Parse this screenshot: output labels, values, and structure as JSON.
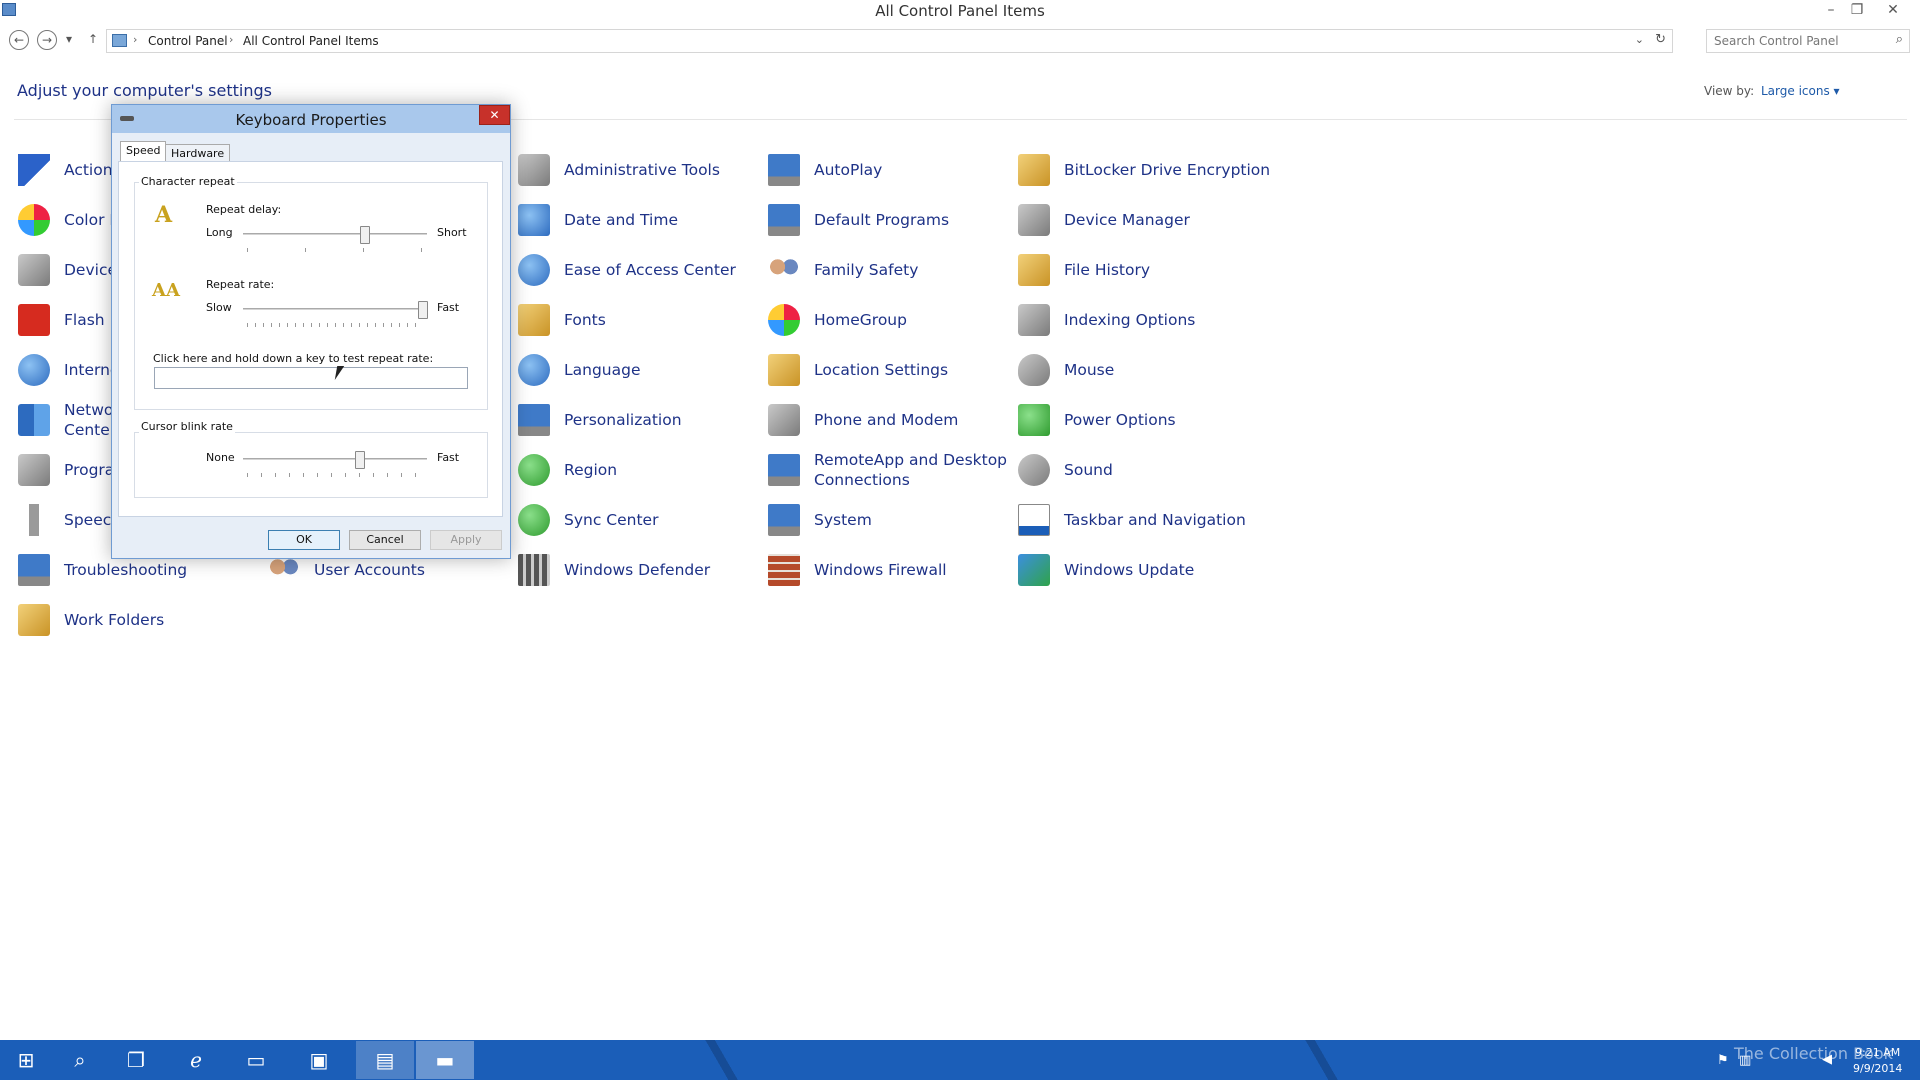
{
  "window": {
    "title": "All Control Panel Items"
  },
  "address": {
    "crumbs": [
      "Control Panel",
      "All Control Panel Items"
    ],
    "search_placeholder": "Search Control Panel"
  },
  "header": {
    "adjust": "Adjust your computer's settings",
    "view_by_label": "View by:",
    "view_by_value": "Large icons"
  },
  "items": [
    {
      "label": "Action",
      "icon": "flag-icon"
    },
    {
      "label": "Color M",
      "icon": "color-management-icon"
    },
    {
      "label": "Devices",
      "icon": "devices-printers-icon"
    },
    {
      "label": "Flash P",
      "icon": "flash-player-icon"
    },
    {
      "label": "Interne",
      "icon": "internet-options-icon"
    },
    {
      "label": "Networ",
      "label2": "Center",
      "icon": "network-sharing-icon"
    },
    {
      "label": "Progra",
      "icon": "programs-features-icon"
    },
    {
      "label": "Speech",
      "icon": "microphone-icon"
    },
    {
      "label": "Troubleshooting",
      "icon": "troubleshooting-icon"
    },
    {
      "label": "Work Folders",
      "icon": "work-folders-icon"
    },
    {
      "label": "User Accounts",
      "icon": "user-accounts-icon"
    },
    {
      "label": "Administrative Tools",
      "icon": "admin-tools-icon"
    },
    {
      "label": "Date and Time",
      "icon": "calendar-icon"
    },
    {
      "label": "Ease of Access Center",
      "icon": "ease-of-access-icon"
    },
    {
      "label": "Fonts",
      "icon": "fonts-icon"
    },
    {
      "label": "Language",
      "icon": "language-icon"
    },
    {
      "label": "Personalization",
      "icon": "personalization-icon"
    },
    {
      "label": "Region",
      "icon": "globe-icon"
    },
    {
      "label": "Sync Center",
      "icon": "sync-icon"
    },
    {
      "label": "Windows Defender",
      "icon": "defender-icon"
    },
    {
      "label": "AutoPlay",
      "icon": "autoplay-icon"
    },
    {
      "label": "Default Programs",
      "icon": "default-programs-icon"
    },
    {
      "label": "Family Safety",
      "icon": "family-safety-icon"
    },
    {
      "label": "HomeGroup",
      "icon": "homegroup-icon"
    },
    {
      "label": "Location Settings",
      "icon": "location-icon"
    },
    {
      "label": "Phone and Modem",
      "icon": "phone-icon"
    },
    {
      "label": "RemoteApp and Desktop",
      "label2": "Connections",
      "icon": "remoteapp-icon"
    },
    {
      "label": "System",
      "icon": "system-icon"
    },
    {
      "label": "Windows Firewall",
      "icon": "firewall-icon"
    },
    {
      "label": "BitLocker Drive Encryption",
      "icon": "bitlocker-icon"
    },
    {
      "label": "Device Manager",
      "icon": "device-manager-icon"
    },
    {
      "label": "File History",
      "icon": "file-history-icon"
    },
    {
      "label": "Indexing Options",
      "icon": "indexing-icon"
    },
    {
      "label": "Mouse",
      "icon": "mouse-icon"
    },
    {
      "label": "Power Options",
      "icon": "power-options-icon"
    },
    {
      "label": "Sound",
      "icon": "speaker-icon"
    },
    {
      "label": "Taskbar and Navigation",
      "icon": "taskbar-icon"
    },
    {
      "label": "Windows Update",
      "icon": "windows-update-icon"
    }
  ],
  "dialog": {
    "title": "Keyboard Properties",
    "tabs": [
      "Speed",
      "Hardware"
    ],
    "char_repeat": "Character repeat",
    "repeat_delay": "Repeat delay:",
    "delay_left": "Long",
    "delay_right": "Short",
    "repeat_rate": "Repeat rate:",
    "rate_left": "Slow",
    "rate_right": "Fast",
    "test_label": "Click here and hold down a key to test repeat rate:",
    "blink_group": "Cursor blink rate",
    "blink_left": "None",
    "blink_right": "Fast",
    "ok": "OK",
    "cancel": "Cancel",
    "apply": "Apply"
  },
  "sliders": {
    "repeat_delay": 0.67,
    "repeat_rate": 1.0,
    "cursor_blink": 0.64
  },
  "taskbar": {
    "time": "9:21 AM",
    "date": "9/9/2014",
    "watermark": "The Collection Book"
  }
}
